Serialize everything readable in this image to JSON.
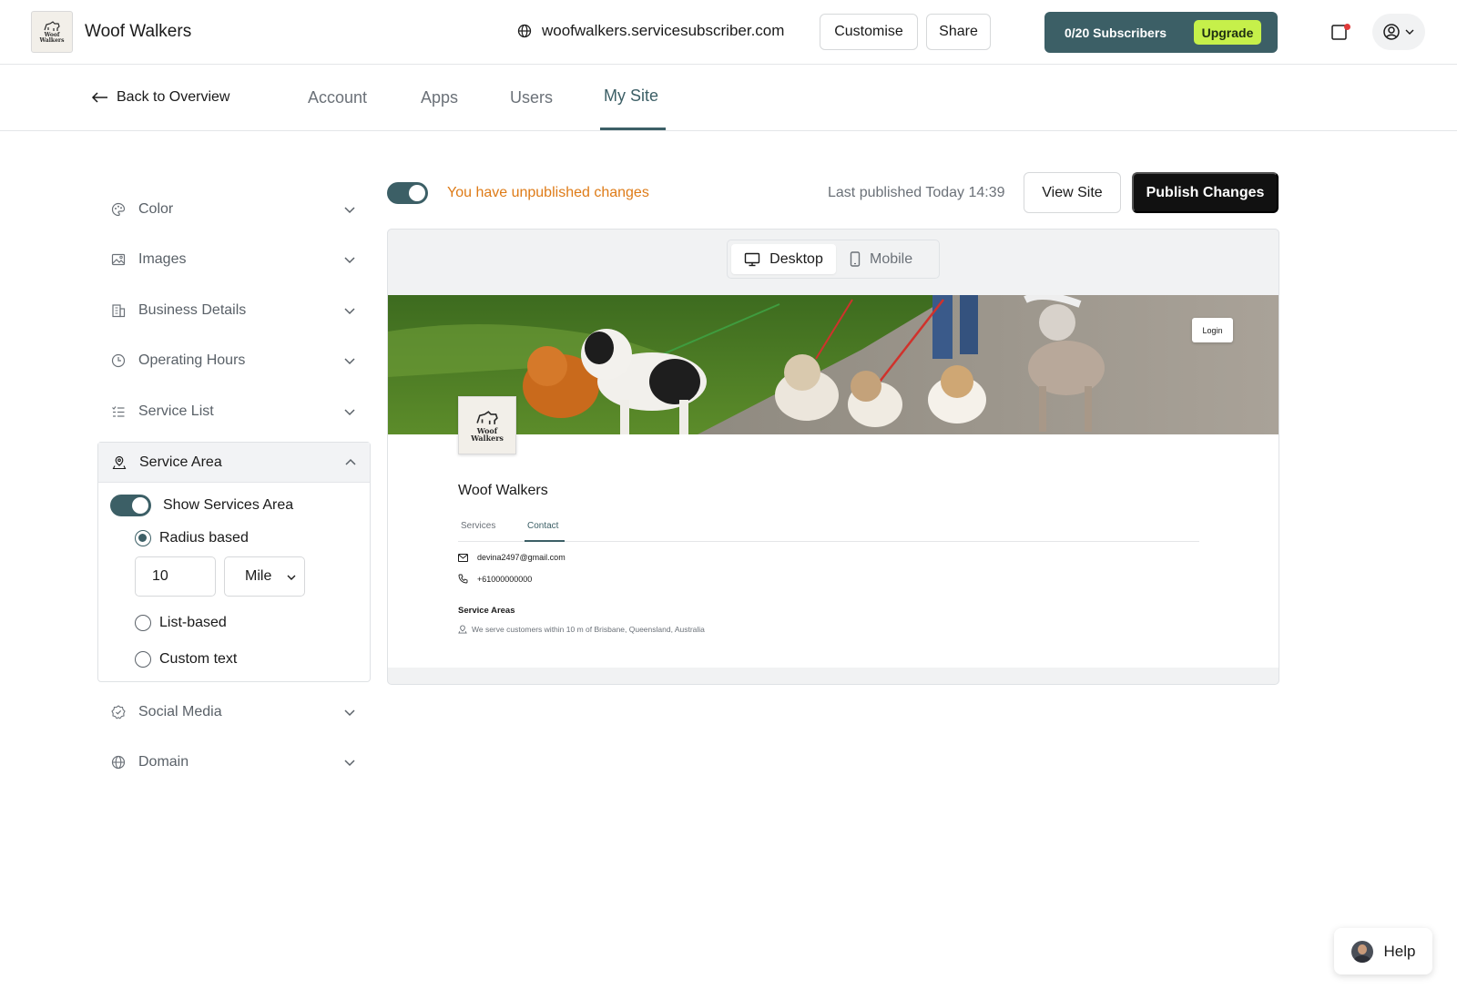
{
  "header": {
    "brand_name": "Woof Walkers",
    "logo_text_line1": "Woof",
    "logo_text_line2": "Walkers",
    "site_url": "woofwalkers.servicesubscriber.com",
    "customise_label": "Customise",
    "share_label": "Share",
    "subscribers_text": "0/20 Subscribers",
    "upgrade_label": "Upgrade",
    "icons": {
      "url": "globe-icon",
      "notifications": "notification-icon",
      "account": "user-circle-icon",
      "account_menu": "chevron-down-icon"
    }
  },
  "nav": {
    "back_label": "Back to Overview",
    "tabs": [
      {
        "label": "Account",
        "active": false
      },
      {
        "label": "Apps",
        "active": false
      },
      {
        "label": "Users",
        "active": false
      },
      {
        "label": "My Site",
        "active": true
      }
    ]
  },
  "sidebar": {
    "items": [
      {
        "label": "Color",
        "icon": "palette-icon",
        "expanded": false
      },
      {
        "label": "Images",
        "icon": "image-icon",
        "expanded": false
      },
      {
        "label": "Business Details",
        "icon": "building-icon",
        "expanded": false
      },
      {
        "label": "Operating Hours",
        "icon": "clock-icon",
        "expanded": false
      },
      {
        "label": "Service List",
        "icon": "list-icon",
        "expanded": false
      },
      {
        "label": "Service Area",
        "icon": "location-icon",
        "expanded": true
      },
      {
        "label": "Social Media",
        "icon": "badge-check-icon",
        "expanded": false
      },
      {
        "label": "Domain",
        "icon": "globe-icon",
        "expanded": false
      }
    ],
    "service_area": {
      "show_label": "Show Services Area",
      "show_enabled": true,
      "options": [
        {
          "label": "Radius based",
          "selected": true
        },
        {
          "label": "List-based",
          "selected": false
        },
        {
          "label": "Custom text",
          "selected": false
        }
      ],
      "radius_value": "10",
      "radius_unit": "Mile"
    }
  },
  "editor": {
    "publish_toggle_on": true,
    "unpublished_text": "You have unpublished changes",
    "last_published": "Last published Today 14:39",
    "view_site_label": "View Site",
    "publish_label": "Publish Changes",
    "device_options": [
      {
        "label": "Desktop",
        "icon": "monitor-icon",
        "active": true
      },
      {
        "label": "Mobile",
        "icon": "smartphone-icon",
        "active": false
      }
    ]
  },
  "preview": {
    "login_label": "Login",
    "site_name": "Woof Walkers",
    "tabs": [
      {
        "label": "Services",
        "active": false
      },
      {
        "label": "Contact",
        "active": true
      }
    ],
    "email": "devina2497@gmail.com",
    "phone": "+61000000000",
    "service_areas_title": "Service Areas",
    "service_areas_text": "We serve customers within 10 m of Brisbane, Queensland, Australia"
  },
  "help": {
    "label": "Help"
  },
  "colors": {
    "accent": "#3c5f66",
    "upgrade": "#c6f04a",
    "warning_text": "#de7b17",
    "primary_button": "#111111"
  }
}
